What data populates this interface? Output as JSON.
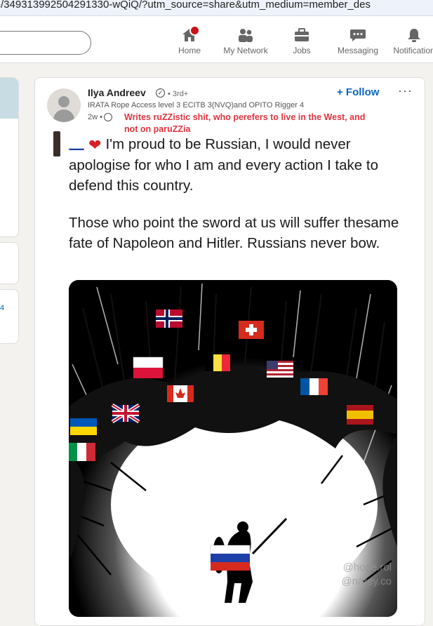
{
  "browser": {
    "url": "-/349313992504291330-wQiQ/?utm_source=share&utm_medium=member_des"
  },
  "nav": {
    "items": [
      {
        "label": "Home",
        "icon": "home-icon"
      },
      {
        "label": "My Network",
        "icon": "network-icon"
      },
      {
        "label": "Jobs",
        "icon": "briefcase-icon"
      },
      {
        "label": "Messaging",
        "icon": "message-icon"
      },
      {
        "label": "Notification",
        "icon": "bell-icon"
      }
    ]
  },
  "sidebar": {
    "link_text": "4"
  },
  "post": {
    "author": {
      "name": "Ilya Andreev",
      "degree": "• 3rd+",
      "headline": "IRATA Rope Access level 3 ECITB 3(NVQ)and OPITO Rigger 4",
      "time": "2w •"
    },
    "annotation": "Writes ruZZistic shit, who perefers to live in the West, and not on paruZZia",
    "follow_label": "+ Follow",
    "more_label": "···",
    "tweet": {
      "paragraph1": "I'm proud to be Russian, I would never apologise for who I am and every action I take to defend this country.",
      "paragraph2": "Those who point the sword at us will suffer thesame fate of Napoleon and Hitler. Russians never bow."
    },
    "image_watermark": [
      "@hope.rol",
      "@narey.co"
    ]
  }
}
